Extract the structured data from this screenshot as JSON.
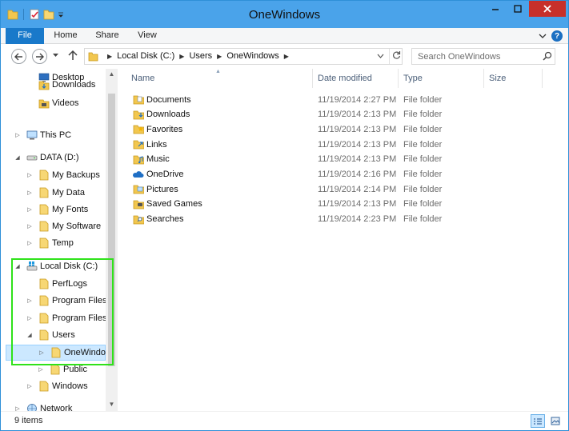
{
  "window": {
    "title": "OneWindows"
  },
  "ribbon": {
    "tabs": [
      "File",
      "Home",
      "Share",
      "View"
    ],
    "help": "?"
  },
  "address": {
    "crumbs": [
      "Local Disk (C:)",
      "Users",
      "OneWindows"
    ],
    "search_placeholder": "Search OneWindows"
  },
  "nav": {
    "items": [
      {
        "label": "Desktop",
        "icon": "desktop-icon",
        "expander": ""
      },
      {
        "label": "Downloads",
        "icon": "downloads-icon",
        "expander": ""
      },
      {
        "label": "Videos",
        "icon": "videos-icon",
        "expander": ""
      },
      {
        "label": "This PC",
        "icon": "computer-icon",
        "expander": "collapsed"
      },
      {
        "label": "DATA (D:)",
        "icon": "drive-icon",
        "expander": "expanded"
      },
      {
        "label": "My Backups",
        "icon": "folder-icon",
        "expander": "collapsed"
      },
      {
        "label": "My Data",
        "icon": "folder-icon",
        "expander": "collapsed"
      },
      {
        "label": "My Fonts",
        "icon": "folder-icon",
        "expander": "collapsed"
      },
      {
        "label": "My Software",
        "icon": "folder-icon",
        "expander": "collapsed"
      },
      {
        "label": "Temp",
        "icon": "folder-icon",
        "expander": "collapsed"
      },
      {
        "label": "Local Disk (C:)",
        "icon": "system-drive-icon",
        "expander": "expanded"
      },
      {
        "label": "PerfLogs",
        "icon": "folder-icon",
        "expander": ""
      },
      {
        "label": "Program Files",
        "icon": "folder-icon",
        "expander": "collapsed"
      },
      {
        "label": "Program Files",
        "icon": "folder-icon",
        "expander": "collapsed"
      },
      {
        "label": "Users",
        "icon": "folder-icon",
        "expander": "expanded"
      },
      {
        "label": "OneWindo",
        "icon": "folder-icon",
        "expander": "collapsed",
        "selected": true
      },
      {
        "label": "Public",
        "icon": "folder-icon",
        "expander": "collapsed"
      },
      {
        "label": "Windows",
        "icon": "folder-icon",
        "expander": "collapsed"
      },
      {
        "label": "Network",
        "icon": "network-icon",
        "expander": "collapsed"
      }
    ]
  },
  "columns": {
    "name": "Name",
    "date": "Date modified",
    "type": "Type",
    "size": "Size"
  },
  "files": [
    {
      "name": "Documents",
      "date": "11/19/2014 2:27 PM",
      "type": "File folder",
      "icon": "documents-folder-icon"
    },
    {
      "name": "Downloads",
      "date": "11/19/2014 2:13 PM",
      "type": "File folder",
      "icon": "downloads-folder-icon"
    },
    {
      "name": "Favorites",
      "date": "11/19/2014 2:13 PM",
      "type": "File folder",
      "icon": "favorites-folder-icon"
    },
    {
      "name": "Links",
      "date": "11/19/2014 2:13 PM",
      "type": "File folder",
      "icon": "links-folder-icon"
    },
    {
      "name": "Music",
      "date": "11/19/2014 2:13 PM",
      "type": "File folder",
      "icon": "music-folder-icon"
    },
    {
      "name": "OneDrive",
      "date": "11/19/2014 2:16 PM",
      "type": "File folder",
      "icon": "onedrive-folder-icon"
    },
    {
      "name": "Pictures",
      "date": "11/19/2014 2:14 PM",
      "type": "File folder",
      "icon": "pictures-folder-icon"
    },
    {
      "name": "Saved Games",
      "date": "11/19/2014 2:13 PM",
      "type": "File folder",
      "icon": "saved-games-folder-icon"
    },
    {
      "name": "Searches",
      "date": "11/19/2014 2:23 PM",
      "type": "File folder",
      "icon": "searches-folder-icon"
    }
  ],
  "status": {
    "text": "9 items"
  },
  "colors": {
    "accent": "#1979ca",
    "title_bar": "#4aa3ea",
    "close": "#c7302a",
    "selection": "#cce8ff",
    "highlight_box": "#2fe21a"
  }
}
